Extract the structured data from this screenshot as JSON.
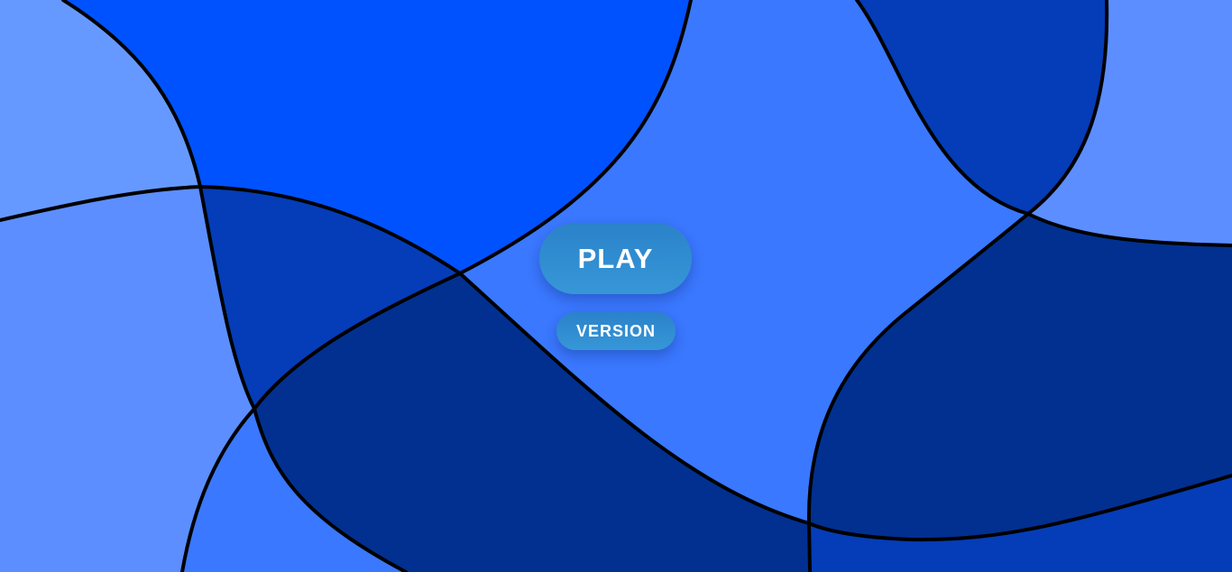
{
  "menu": {
    "play_label": "PLAY",
    "version_label": "VERSION"
  },
  "palette": {
    "tile_light": "#6699ff",
    "tile_bright": "#0052ff",
    "tile_mid": "#3a78ff",
    "tile_medium_dark": "#053cb8",
    "tile_dark": "#023091",
    "tile_pale": "#5c8eff",
    "outline": "#000000",
    "button": "#2e8bd0"
  }
}
